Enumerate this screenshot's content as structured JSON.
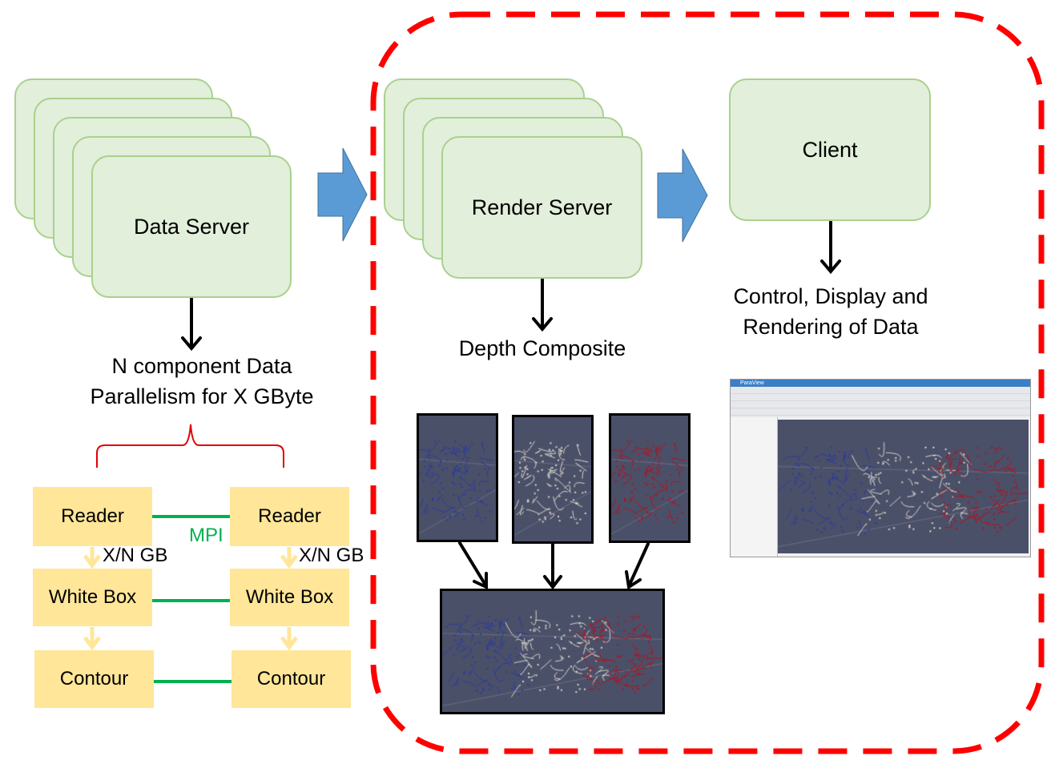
{
  "data_server": {
    "label": "Data Server",
    "stack_count": 5
  },
  "render_server": {
    "label": "Render Server",
    "stack_count": 4
  },
  "client": {
    "label": "Client"
  },
  "data_parallel_caption": {
    "line1": "N component Data",
    "line2": "Parallelism for X GByte"
  },
  "depth_composite_caption": "Depth Composite",
  "client_caption": {
    "line1": "Control, Display and",
    "line2": "Rendering of Data"
  },
  "pipeline": {
    "left": [
      "Reader",
      "White Box",
      "Contour"
    ],
    "right": [
      "Reader",
      "White Box",
      "Contour"
    ],
    "mpi_label": "MPI",
    "transfer_label": "X/N GB"
  },
  "paraview_window_title": "ParaView",
  "colors": {
    "server_fill": "#e2efda",
    "server_border": "#a9d18e",
    "pipeline_fill": "#ffe699",
    "mpi": "#00b050",
    "flow_arrow": "#5b9bd5",
    "boundary": "#ff0000",
    "brace": "#e00000",
    "render_bg": "#4b5069"
  }
}
